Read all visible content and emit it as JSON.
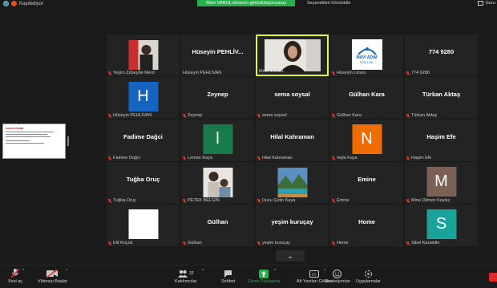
{
  "topbar": {
    "recording_label": "Kaydediyor",
    "share_banner": "Mine VAROL ekranını görüntülüyorsunuz",
    "view_options": "Seçenekleri Görüntüle",
    "gallery_label": "Goru"
  },
  "colors": {
    "share_green": "#26b24b",
    "active_border": "#e5ff32",
    "mute_red": "#e33333",
    "end_red": "#e02828"
  },
  "tiles": [
    {
      "display": "",
      "label": "Yeşim Zübeyde Merd",
      "muted": true,
      "kind": "photo-woman"
    },
    {
      "display": "Hüseyin  PEHLİV...",
      "label": "Hüseyin PEHLİVAN",
      "muted": false,
      "kind": "text"
    },
    {
      "display": "",
      "label": "Mine VAROL",
      "muted": false,
      "kind": "video",
      "active": true
    },
    {
      "display": "",
      "label": "Hüseyin Limon",
      "muted": true,
      "kind": "logo",
      "logo_line1": "MAVİ ADIM",
      "logo_line2": "KOÇLUK"
    },
    {
      "display": "774 9280",
      "label": "774 9280",
      "muted": true,
      "kind": "text"
    },
    {
      "display": "H",
      "label": "Hüseyin PEHLİVAN",
      "muted": true,
      "kind": "avatar",
      "color": "#1565c0"
    },
    {
      "display": "Zeynep",
      "label": "Zeynep",
      "muted": true,
      "kind": "text"
    },
    {
      "display": "sema soysal",
      "label": "sema soysal",
      "muted": true,
      "kind": "text"
    },
    {
      "display": "Gülhan Kara",
      "label": "Gülhan Kara",
      "muted": true,
      "kind": "text"
    },
    {
      "display": "Türkan Aktaş",
      "label": "Türkan Aktaş",
      "muted": true,
      "kind": "text"
    },
    {
      "display": "Fadime Dağci",
      "label": "Fadime Dağci",
      "muted": true,
      "kind": "text"
    },
    {
      "display": "l",
      "label": "Leman Kaya",
      "muted": true,
      "kind": "avatar",
      "color": "#1b7a4a"
    },
    {
      "display": "Hilal Kahraman",
      "label": "Hilal Kahraman",
      "muted": true,
      "kind": "text"
    },
    {
      "display": "N",
      "label": "nejla Kaya",
      "muted": true,
      "kind": "avatar",
      "color": "#ef6c00"
    },
    {
      "display": "Haşim Efe",
      "label": "Haşim Efe",
      "muted": true,
      "kind": "text"
    },
    {
      "display": "Tuğba Oruç",
      "label": "Tuğba Oruç",
      "muted": true,
      "kind": "text"
    },
    {
      "display": "",
      "label": "PETEK BELGİN",
      "muted": true,
      "kind": "photo-family"
    },
    {
      "display": "",
      "label": "Ducu Çetin Kaya",
      "muted": true,
      "kind": "photo-landscape"
    },
    {
      "display": "Emine",
      "label": "Emine",
      "muted": true,
      "kind": "text"
    },
    {
      "display": "M",
      "label": "Mine Dilmen Kayıkç",
      "muted": true,
      "kind": "avatar",
      "color": "#7b6055"
    },
    {
      "display": "",
      "label": "Elif Küçük",
      "muted": true,
      "kind": "white"
    },
    {
      "display": "Gülhan",
      "label": "Gülhan",
      "muted": true,
      "kind": "text"
    },
    {
      "display": "yeşim kuruçay",
      "label": "yeşim kuruçay",
      "muted": true,
      "kind": "text"
    },
    {
      "display": "Home",
      "label": "Home",
      "muted": true,
      "kind": "text"
    },
    {
      "display": "S",
      "label": "Sibel Karatelle",
      "muted": true,
      "kind": "avatar",
      "color": "#1aa39a"
    }
  ],
  "slide": {
    "title": "KARAR VERME"
  },
  "toolbar": {
    "audio": "Sesi aç",
    "video": "Videoyu Başlat",
    "participants": "Katılımcılar",
    "participants_count": "32",
    "chat": "Sohbet",
    "share": "Ekran Paylaşma",
    "captions": "Alt Yazıları Göster",
    "reactions": "Reaksiyonlar",
    "apps": "Uygulamalar",
    "chevron": "⌄"
  }
}
